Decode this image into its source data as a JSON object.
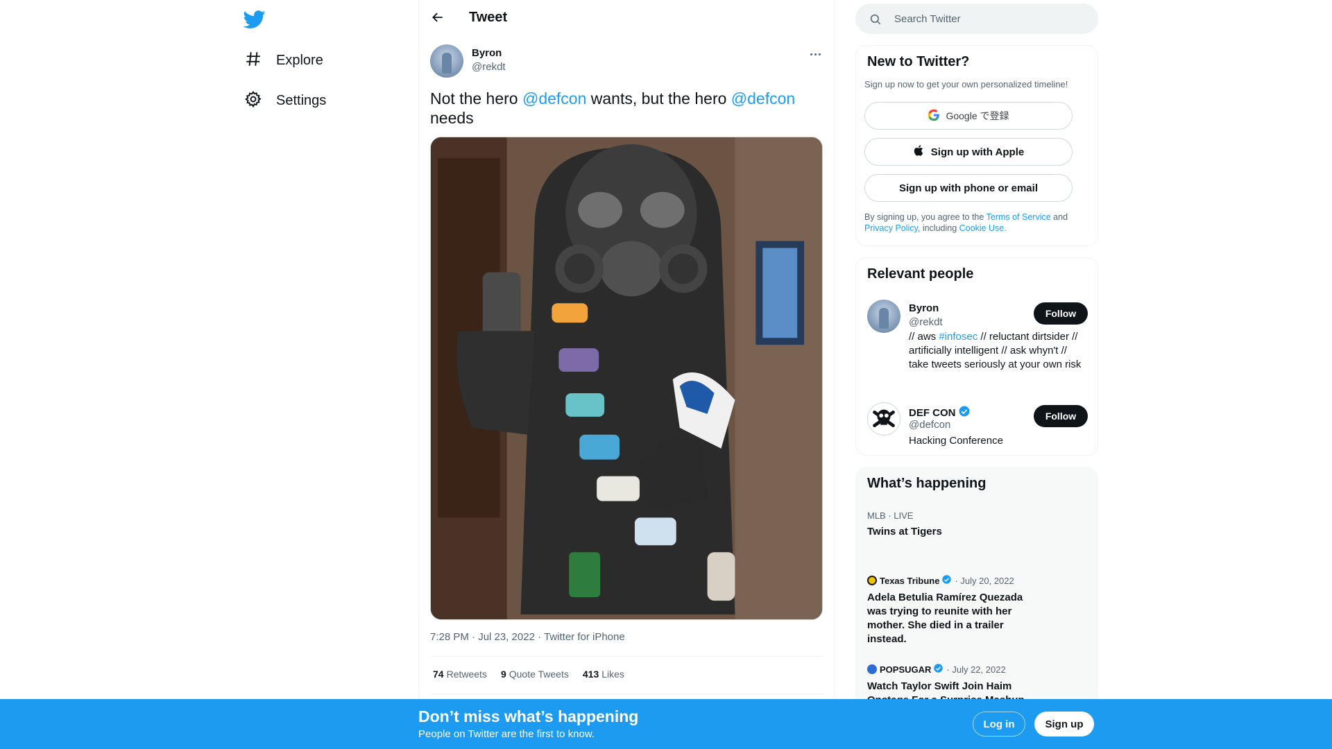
{
  "colors": {
    "brand": "#1d9bf0",
    "text": "#0f1419",
    "muted": "#536471",
    "border": "#eff3f4"
  },
  "nav": {
    "logo_icon": "twitter-bird-icon",
    "items": [
      {
        "label": "Explore",
        "icon": "hashtag-icon"
      },
      {
        "label": "Settings",
        "icon": "gear-icon"
      }
    ]
  },
  "header": {
    "title": "Tweet",
    "back_icon": "arrow-left-icon"
  },
  "tweet": {
    "author_name": "Byron",
    "author_handle": "@rekdt",
    "text_parts": [
      "Not the hero ",
      "@defcon",
      " wants, but the hero ",
      "@defcon",
      " needs"
    ],
    "meta": "7:28 PM · Jul 23, 2022 · Twitter for iPhone",
    "stats": [
      {
        "count": "74",
        "label": "Retweets"
      },
      {
        "count": "9",
        "label": "Quote Tweets"
      },
      {
        "count": "413",
        "label": "Likes"
      }
    ]
  },
  "search": {
    "placeholder": "Search Twitter"
  },
  "new_to_twitter": {
    "title": "New to Twitter?",
    "subtitle": "Sign up now to get your own personalized timeline!",
    "google_label": "Google で登録",
    "apple_label": "Sign up with Apple",
    "phone_label": "Sign up with phone or email",
    "legal_prefix": "By signing up, you agree to the ",
    "terms": "Terms of Service",
    "and": " and ",
    "privacy": "Privacy Policy",
    "including": ", including ",
    "cookie": "Cookie Use."
  },
  "relevant_people": {
    "title": "Relevant people",
    "people": [
      {
        "name": "Byron",
        "handle": "@rekdt",
        "bio_before": "// aws ",
        "bio_tag": "#infosec",
        "bio_after": " // reluctant dirtsider // artificially intelligent // ask whyn't // take tweets seriously at your own risk",
        "follow": "Follow",
        "verified": false
      },
      {
        "name": "DEF CON",
        "handle": "@defcon",
        "bio": "Hacking Conference",
        "follow": "Follow",
        "verified": true
      }
    ]
  },
  "happening": {
    "title": "What’s happening",
    "trends": [
      {
        "meta": "MLB · LIVE",
        "title": "Twins at Tigers"
      },
      {
        "source": "Texas Tribune",
        "date": "· July 20, 2022",
        "title": "Adela Betulia Ramírez Quezada was trying to reunite with her mother. She died in a trailer instead.",
        "verified": true
      },
      {
        "source": "POPSUGAR",
        "date": "· July 22, 2022",
        "title": "Watch Taylor Swift Join Haim Onstage For a Surprise Mashup",
        "verified": true
      }
    ]
  },
  "banner": {
    "title": "Don’t miss what’s happening",
    "subtitle": "People on Twitter are the first to know.",
    "login": "Log in",
    "signup": "Sign up"
  }
}
